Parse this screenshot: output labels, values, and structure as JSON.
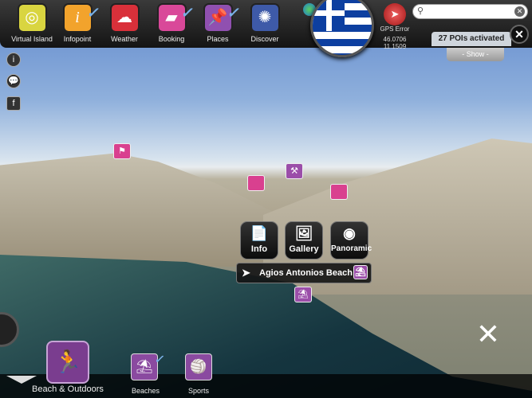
{
  "toolbar": {
    "apps": [
      {
        "label": "Virtual Island",
        "icon": "globe-icon",
        "color": "#d9d540",
        "checked": false
      },
      {
        "label": "Infopoint",
        "icon": "info-icon",
        "color": "#f2a32c",
        "checked": true
      },
      {
        "label": "Weather",
        "icon": "cloud-icon",
        "color": "#d9303a",
        "checked": false
      },
      {
        "label": "Booking",
        "icon": "suitcase-icon",
        "color": "#d94899",
        "checked": true
      },
      {
        "label": "Places",
        "icon": "pushpin-icon",
        "color": "#9050b0",
        "checked": true
      },
      {
        "label": "Discover",
        "icon": "compass-icon",
        "color": "#3e5aa8",
        "checked": false
      }
    ]
  },
  "gps": {
    "label": "GPS Error",
    "lat": "46.0706",
    "lon": "11.1509"
  },
  "search": {
    "placeholder": ""
  },
  "pois": {
    "status": "27 POIs activated",
    "show": "- Show -"
  },
  "actions": {
    "info": "Info",
    "gallery": "Gallery",
    "panoramic": "Panoramic"
  },
  "poi": {
    "name": "Agios Antonios Beach"
  },
  "bottom": {
    "category": "Beach & Outdoors",
    "subs": [
      {
        "label": "Beaches",
        "checked": true
      },
      {
        "label": "Sports",
        "checked": false
      }
    ]
  }
}
